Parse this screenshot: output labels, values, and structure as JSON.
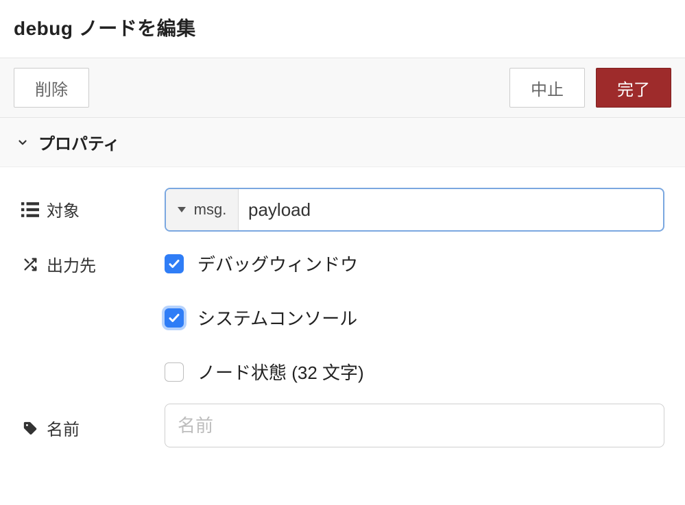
{
  "title": "debug ノードを編集",
  "actions": {
    "delete": "削除",
    "cancel": "中止",
    "done": "完了"
  },
  "section": {
    "properties": "プロパティ"
  },
  "form": {
    "target_label": "対象",
    "target_prefix": "msg.",
    "target_value": "payload",
    "output_label": "出力先",
    "output_options": [
      {
        "label": "デバッグウィンドウ",
        "checked": true,
        "focus": false
      },
      {
        "label": "システムコンソール",
        "checked": true,
        "focus": true
      },
      {
        "label": "ノード状態 (32 文字)",
        "checked": false,
        "focus": false
      }
    ],
    "name_label": "名前",
    "name_placeholder": "名前",
    "name_value": ""
  },
  "colors": {
    "primary_button": "#9e2b2b",
    "focus_border": "#7aa7e0",
    "checkbox_checked": "#2f7df6"
  }
}
